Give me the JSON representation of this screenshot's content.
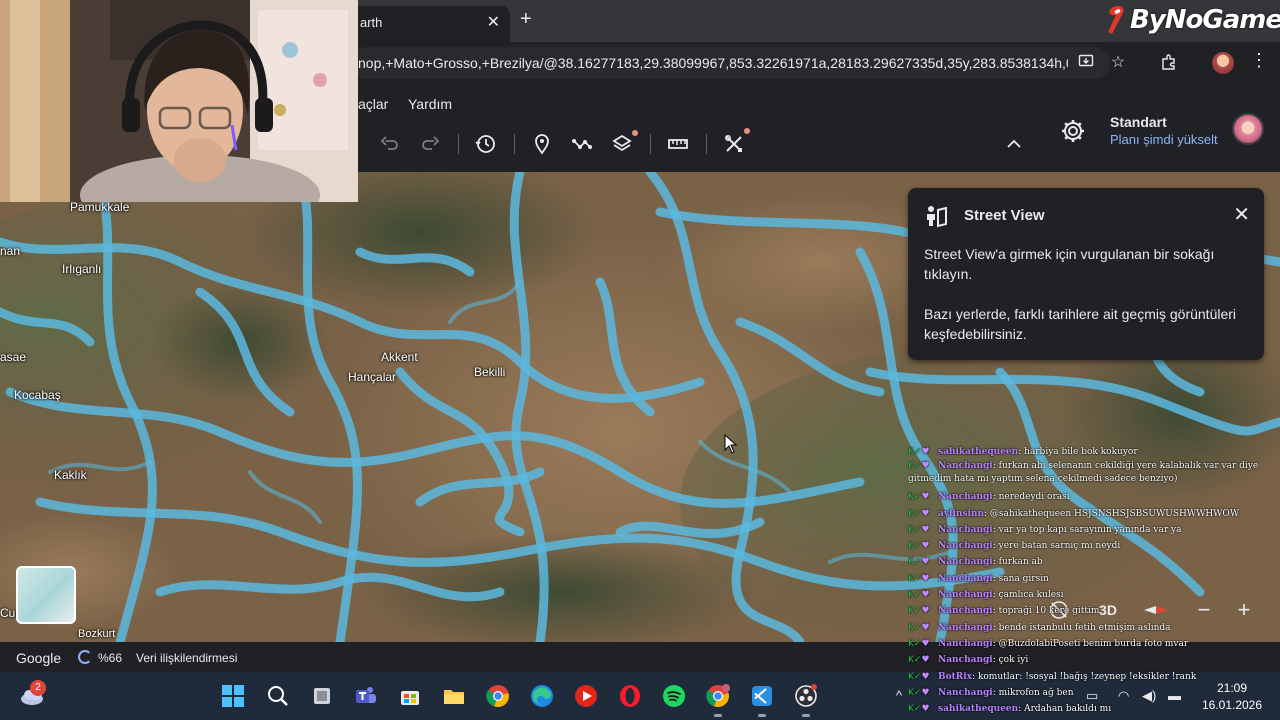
{
  "browser": {
    "tab_title": "arth",
    "tab_close": "✕",
    "new_tab": "+",
    "url": "nop,+Mato+Grosso,+Brezilya/@38.16277183,29.38099967,853.32261971a,28183.29627335d,35y,283.8538134h,0..."
  },
  "watermark": {
    "text": "ByNoGame"
  },
  "app_menu": {
    "items": [
      "açlar",
      "Yardım"
    ]
  },
  "account": {
    "plan_title": "Standart",
    "plan_link": "Planı şimdi yükselt"
  },
  "map": {
    "places": [
      "Pamukkale",
      "Irlıganlı",
      "Akkent",
      "Hançalar",
      "Bekilli",
      "Kocabaş",
      "Kaklık",
      "Bozkurt",
      "nan",
      "asae",
      "Cur"
    ]
  },
  "street_view": {
    "title": "Street View",
    "close": "✕",
    "text1": "Street View'a girmek için vurgulanan bir sokağı tıklayın.",
    "text2": "Bazı yerlerde, farklı tarihlere ait geçmiş görüntüleri keşfedebilirsiniz."
  },
  "controls": {
    "mode_3d": "3D",
    "zoom_out": "−",
    "zoom_in": "+"
  },
  "status": {
    "google": "Google",
    "progress": "%66",
    "attribution": "Veri ilişkilendirmesi"
  },
  "chat": [
    {
      "user": "sahikathequeen",
      "msg": "harbiya bile bok kokuyor"
    },
    {
      "user": "Nanchangi",
      "msg": "furkan abi selenanın cekildiği yere kalabalık var var diye gitmedim hata mı yaptım selena çekilmedi sadece benziyo)",
      "wrap": true
    },
    {
      "user": "Nanchangi",
      "msg": "neredeydi orası"
    },
    {
      "user": "aylinsinn",
      "msg": "@sahikathequeen HSJSNSHSJSBSUWUSHWWHWOW"
    },
    {
      "user": "Nanchangi",
      "msg": "var ya top kapı sarayının yanında var ya"
    },
    {
      "user": "Nanchangi",
      "msg": "yere batan sarnıç mı neydi"
    },
    {
      "user": "Nanchangi",
      "msg": "furkan ab"
    },
    {
      "user": "Nanchangi",
      "msg": "sana girsin"
    },
    {
      "user": "Nanchangi",
      "msg": "çamlıca kulesi"
    },
    {
      "user": "Nanchangi",
      "msg": "topraği 10 kere gittim"
    },
    {
      "user": "Nanchangi",
      "msg": "bende istanbulu fetih etmişim aslında"
    },
    {
      "user": "Nanchangi",
      "msg": "@BuzdolabiPoseti benim burda foto mvar"
    },
    {
      "user": "Nanchangi",
      "msg": "çok iyi"
    },
    {
      "user": "BotRix",
      "msg": "komutlar: !sosyal !bağış !zeynep !eksikler !rank"
    },
    {
      "user": "Nanchangi",
      "msg": "mikrofon ağ ben"
    },
    {
      "user": "sahikathequeen",
      "msg": "Ardahan bakıldı mı"
    }
  ],
  "taskbar": {
    "weather_badge": "2",
    "time": "21:09",
    "date": "16.01.2026",
    "apps": [
      "start-icon",
      "search-icon",
      "task-view-icon",
      "teams-icon",
      "store-icon",
      "file-explorer-icon",
      "chrome-icon",
      "edge-icon",
      "media-player-icon",
      "opera-icon",
      "spotify-icon",
      "chrome-profile-icon",
      "vs-code-icon",
      "obs-icon"
    ]
  },
  "colors": {
    "street_view_overlay": "#5bb9df",
    "accent_link": "#8ab4f8",
    "chat_username": "#b981ff"
  }
}
